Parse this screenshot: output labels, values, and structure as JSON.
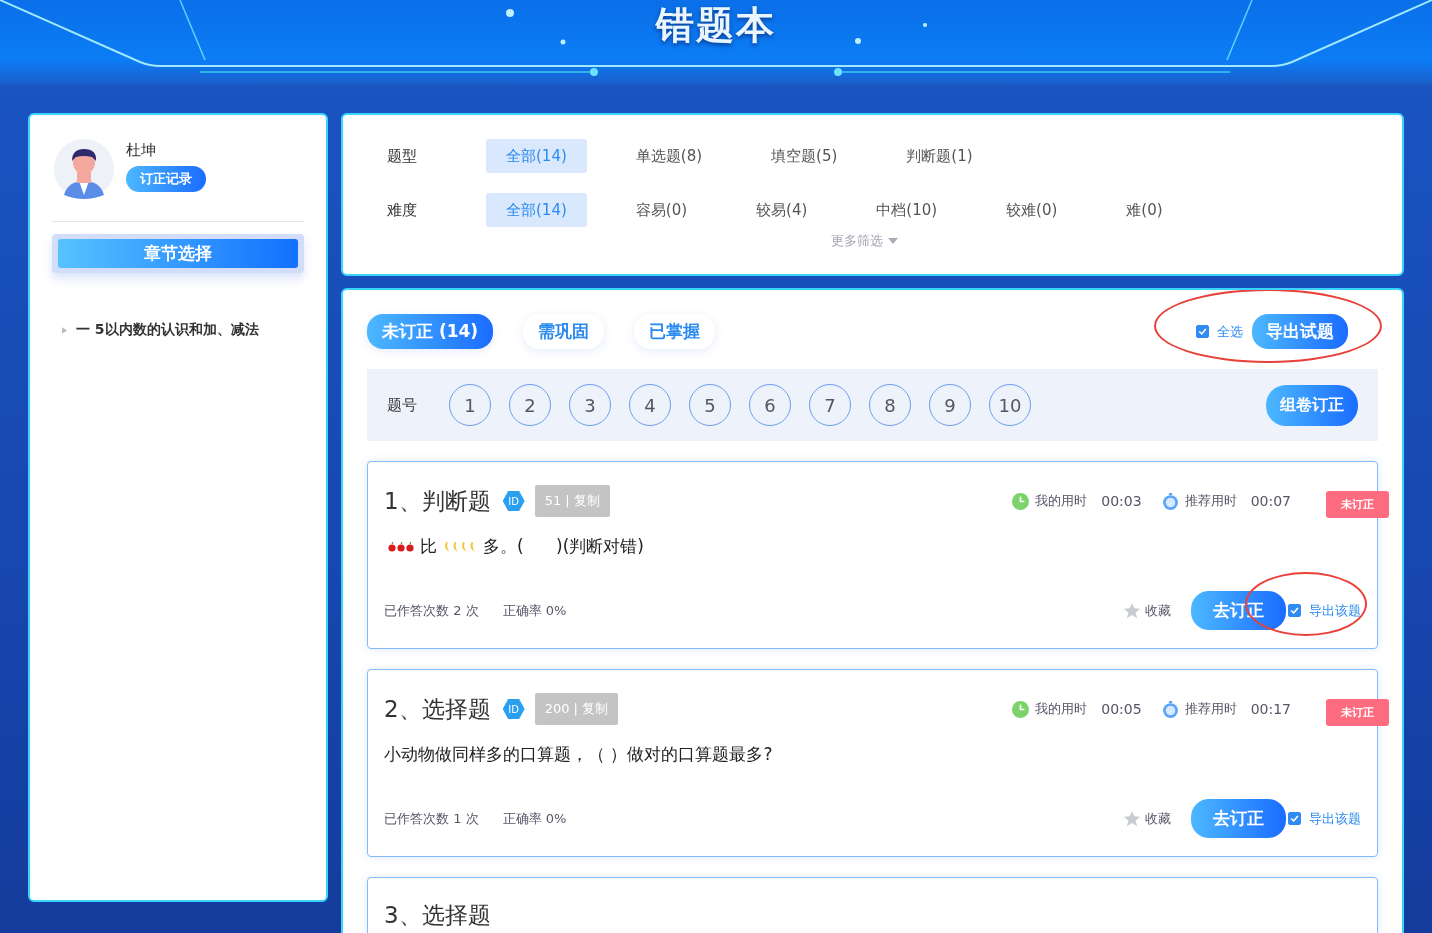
{
  "header": {
    "title": "错题本"
  },
  "user": {
    "name": "杜坤",
    "record_button": "订正记录"
  },
  "chapter_button": "章节选择",
  "chapters": [
    {
      "label": "一 5以内数的认识和加、减法",
      "expanded": false
    }
  ],
  "filters": [
    {
      "label": "题型",
      "options": [
        {
          "text": "全部(14)",
          "selected": true
        },
        {
          "text": "单选题(8)",
          "selected": false
        },
        {
          "text": "填空题(5)",
          "selected": false
        },
        {
          "text": "判断题(1)",
          "selected": false
        }
      ]
    },
    {
      "label": "难度",
      "options": [
        {
          "text": "全部(14)",
          "selected": true
        },
        {
          "text": "容易(0)",
          "selected": false
        },
        {
          "text": "较易(4)",
          "selected": false
        },
        {
          "text": "中档(10)",
          "selected": false
        },
        {
          "text": "较难(0)",
          "selected": false
        },
        {
          "text": "难(0)",
          "selected": false
        }
      ]
    }
  ],
  "more_filters": "更多筛选",
  "status_tabs": [
    {
      "text": "未订正 (14)",
      "selected": true
    },
    {
      "text": "需巩固",
      "selected": false
    },
    {
      "text": "已掌握",
      "selected": false
    }
  ],
  "select_all": {
    "label": "全选",
    "checked": true
  },
  "export_button": "导出试题",
  "number_row": {
    "label": "题号",
    "numbers": [
      "1",
      "2",
      "3",
      "4",
      "5",
      "6",
      "7",
      "8",
      "9",
      "10"
    ],
    "compose_button": "组卷订正"
  },
  "questions": [
    {
      "title": "1、判断题",
      "id_badge": "ID",
      "copy_badge": "51 | 复制",
      "my_time_label": "我的用时",
      "my_time": "00:03",
      "rec_time_label": "推荐用时",
      "rec_time": "00:07",
      "status": "未订正",
      "kind": "picture_text",
      "parts": [
        "比",
        "多。(      )(判断对错)"
      ],
      "attempts": "已作答次数 2 次",
      "accuracy": "正确率 0%",
      "favorite": "收藏",
      "fix_button": "去订正",
      "export": {
        "label": "导出该题",
        "checked": true
      },
      "annotated": true
    },
    {
      "title": "2、选择题",
      "id_badge": "ID",
      "copy_badge": "200 | 复制",
      "my_time_label": "我的用时",
      "my_time": "00:05",
      "rec_time_label": "推荐用时",
      "rec_time": "00:17",
      "status": "未订正",
      "kind": "text",
      "parts": [
        "小动物做同样多的口算题，（ ）做对的口算题最多?"
      ],
      "attempts": "已作答次数 1 次",
      "accuracy": "正确率 0%",
      "favorite": "收藏",
      "fix_button": "去订正",
      "export": {
        "label": "导出该题",
        "checked": true
      },
      "annotated": false
    },
    {
      "title": "3、选择题",
      "kind": "cut"
    }
  ]
}
